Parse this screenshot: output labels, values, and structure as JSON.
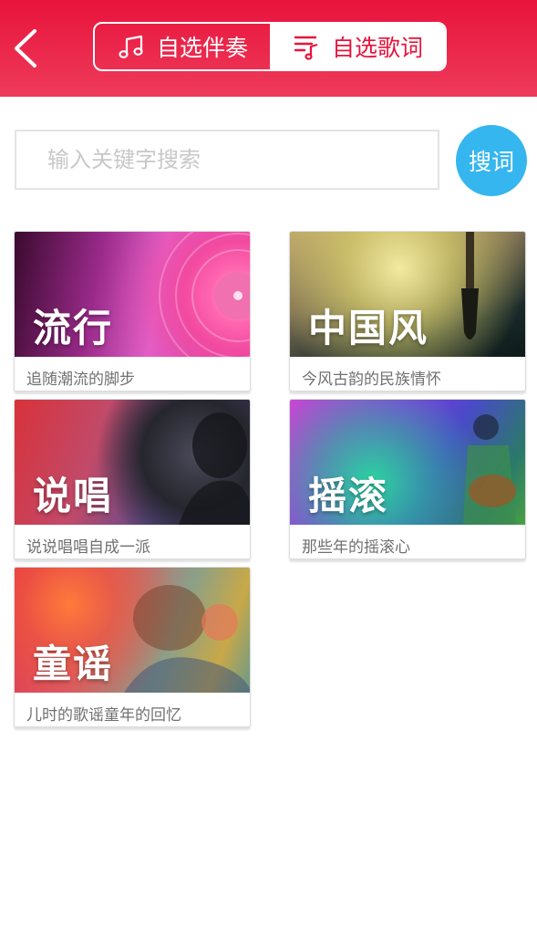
{
  "header": {
    "tabs": [
      {
        "label": "自选伴奏",
        "icon": "music-note-icon",
        "selected": false
      },
      {
        "label": "自选歌词",
        "icon": "lyrics-icon",
        "selected": true
      }
    ],
    "accent_color": "#e8133b"
  },
  "search": {
    "placeholder": "输入关键字搜索",
    "button_label": "搜词",
    "button_color": "#35b6ef"
  },
  "categories": [
    {
      "title": "流行",
      "subtitle": "追随潮流的脚步"
    },
    {
      "title": "中国风",
      "subtitle": "今风古韵的民族情怀"
    },
    {
      "title": "说唱",
      "subtitle": "说说唱唱自成一派"
    },
    {
      "title": "摇滚",
      "subtitle": "那些年的摇滚心"
    },
    {
      "title": "童谣",
      "subtitle": "儿时的歌谣童年的回忆"
    }
  ]
}
